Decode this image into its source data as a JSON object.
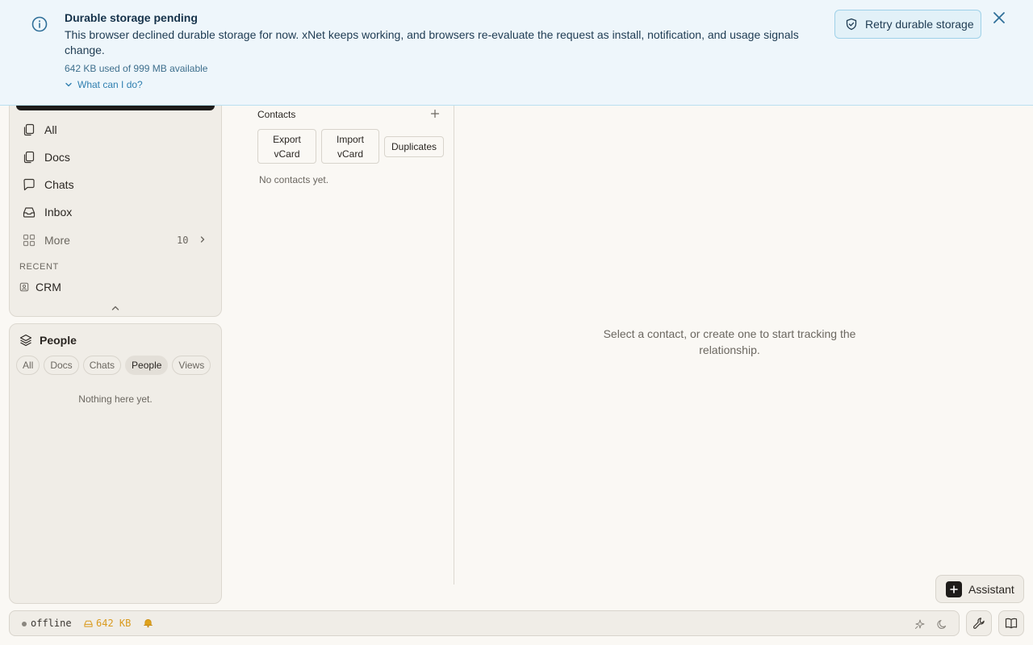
{
  "banner": {
    "title": "Durable storage pending",
    "message": "This browser declined durable storage for now. xNet keeps working, and browsers re-evaluate the request as install, notification, and usage signals change.",
    "usage": "642 KB used of 999 MB available",
    "help_label": "What can I do?",
    "retry_label": "Retry durable storage",
    "accent": "#2f7fb0"
  },
  "nav": {
    "items": [
      {
        "label": "All",
        "icon": "copy-icon"
      },
      {
        "label": "Docs",
        "icon": "copy-icon"
      },
      {
        "label": "Chats",
        "icon": "message-icon"
      },
      {
        "label": "Inbox",
        "icon": "inbox-icon"
      }
    ],
    "more": {
      "label": "More",
      "count": "10"
    },
    "recent_label": "RECENT",
    "recent_items": [
      {
        "label": "CRM",
        "icon": "contact-card-icon"
      }
    ]
  },
  "people_panel": {
    "title": "People",
    "filters": [
      "All",
      "Docs",
      "Chats",
      "People",
      "Views"
    ],
    "active_filter": "People",
    "empty_text": "Nothing here yet."
  },
  "contacts": {
    "title": "Contacts",
    "export_label": "Export vCard",
    "import_label": "Import vCard",
    "duplicates_label": "Duplicates",
    "empty_text": "No contacts yet."
  },
  "detail": {
    "empty_text": "Select a contact, or create one to start tracking the relationship."
  },
  "assistant": {
    "label": "Assistant"
  },
  "status": {
    "connection": "offline",
    "storage": "642 KB",
    "storage_color": "#d99a1e"
  }
}
